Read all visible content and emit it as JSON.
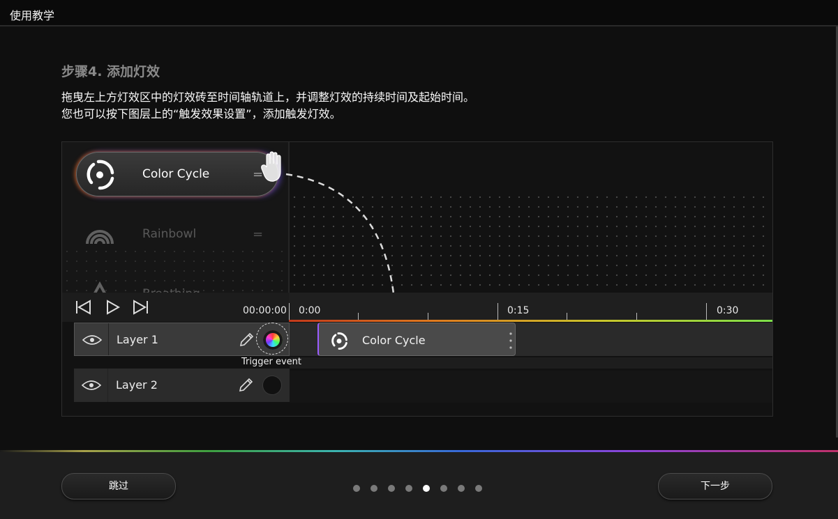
{
  "window": {
    "title": "使用教学"
  },
  "step": {
    "title": "步骤4. 添加灯效",
    "lines": [
      "拖曳左上方灯效区中的灯效砖至时间轴轨道上，并调整灯效的持续时间及起始时间。",
      "您也可以按下图层上的“触发效果设置”，添加触发灯效。"
    ]
  },
  "effects": [
    {
      "label": "Color Cycle",
      "icon": "color-cycle-icon",
      "state": "dragging"
    },
    {
      "label": "Rainbowl",
      "icon": "rainbow-icon",
      "state": "dim"
    },
    {
      "label": "Breathing",
      "icon": "breathing-icon",
      "state": "dim"
    }
  ],
  "timeline": {
    "timecode": "00:00:00",
    "ticks": [
      "0:00",
      "0:15",
      "0:30"
    ]
  },
  "layers": [
    {
      "label": "Layer 1",
      "trigger_label": "Trigger event"
    },
    {
      "label": "Layer 2"
    }
  ],
  "track_block": {
    "label": "Color Cycle"
  },
  "footer": {
    "skip_label": "跳过",
    "next_label": "下一步",
    "page_count": 8,
    "current_page": 5
  },
  "colors": {
    "accent_orange": "#e07b20",
    "accent_purple": "#9b5cff",
    "accent_green": "#7de04a"
  }
}
